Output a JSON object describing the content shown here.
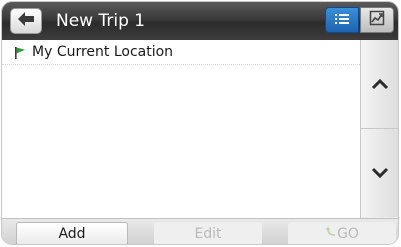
{
  "header": {
    "title": "New Trip 1",
    "back_icon": "back-arrow-icon",
    "view_toggle": {
      "selected": "list",
      "options": [
        {
          "id": "list",
          "icon": "list-view-icon"
        },
        {
          "id": "map",
          "icon": "map-view-icon"
        }
      ]
    }
  },
  "trip_list": {
    "items": [
      {
        "label": "My Current Location",
        "icon": "flag-icon",
        "icon_color": "#2e9b3b"
      }
    ]
  },
  "scroll": {
    "up_icon": "chevron-up-icon",
    "down_icon": "chevron-down-icon"
  },
  "toolbar": {
    "add_label": "Add",
    "edit_label": "Edit",
    "go_label": "GO",
    "edit_enabled": false,
    "go_enabled": false
  },
  "colors": {
    "header_bg": "#333333",
    "accent_blue": "#1d63b0",
    "disabled_text": "#b9b9b9"
  }
}
